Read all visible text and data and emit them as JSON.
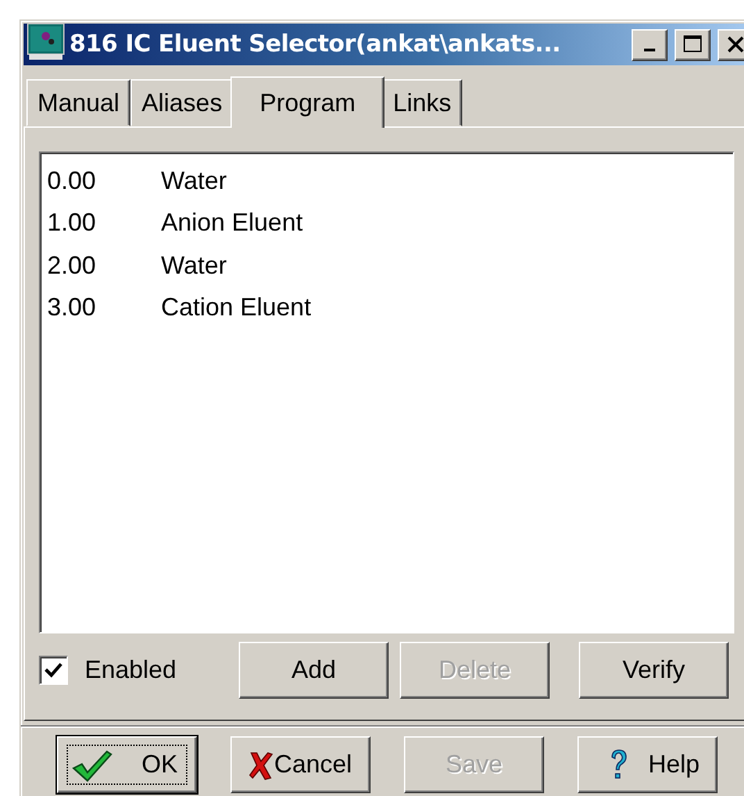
{
  "window": {
    "title": "816 IC Eluent Selector(ankat\\ankats..."
  },
  "tabs": [
    {
      "label": "Manual",
      "selected": false
    },
    {
      "label": "Aliases",
      "selected": false
    },
    {
      "label": "Program",
      "selected": true
    },
    {
      "label": "Links",
      "selected": false
    }
  ],
  "program": [
    {
      "time": "0.00",
      "eluent": "Water"
    },
    {
      "time": "1.00",
      "eluent": "Anion Eluent"
    },
    {
      "time": "2.00",
      "eluent": "Water"
    },
    {
      "time": "3.00",
      "eluent": "Cation Eluent"
    }
  ],
  "enabled": {
    "label": "Enabled",
    "checked": true
  },
  "list_buttons": [
    {
      "label": "Add",
      "disabled": false
    },
    {
      "label": "Delete",
      "disabled": true
    },
    {
      "label": "Verify",
      "disabled": false
    }
  ],
  "dialog_buttons": [
    {
      "label": "OK",
      "kind": "ok",
      "default": true,
      "disabled": false
    },
    {
      "label": "Cancel",
      "kind": "cancel",
      "default": false,
      "disabled": false
    },
    {
      "label": "Save",
      "kind": "plain",
      "default": false,
      "disabled": true
    },
    {
      "label": "Help",
      "kind": "help",
      "default": false,
      "disabled": false
    }
  ]
}
